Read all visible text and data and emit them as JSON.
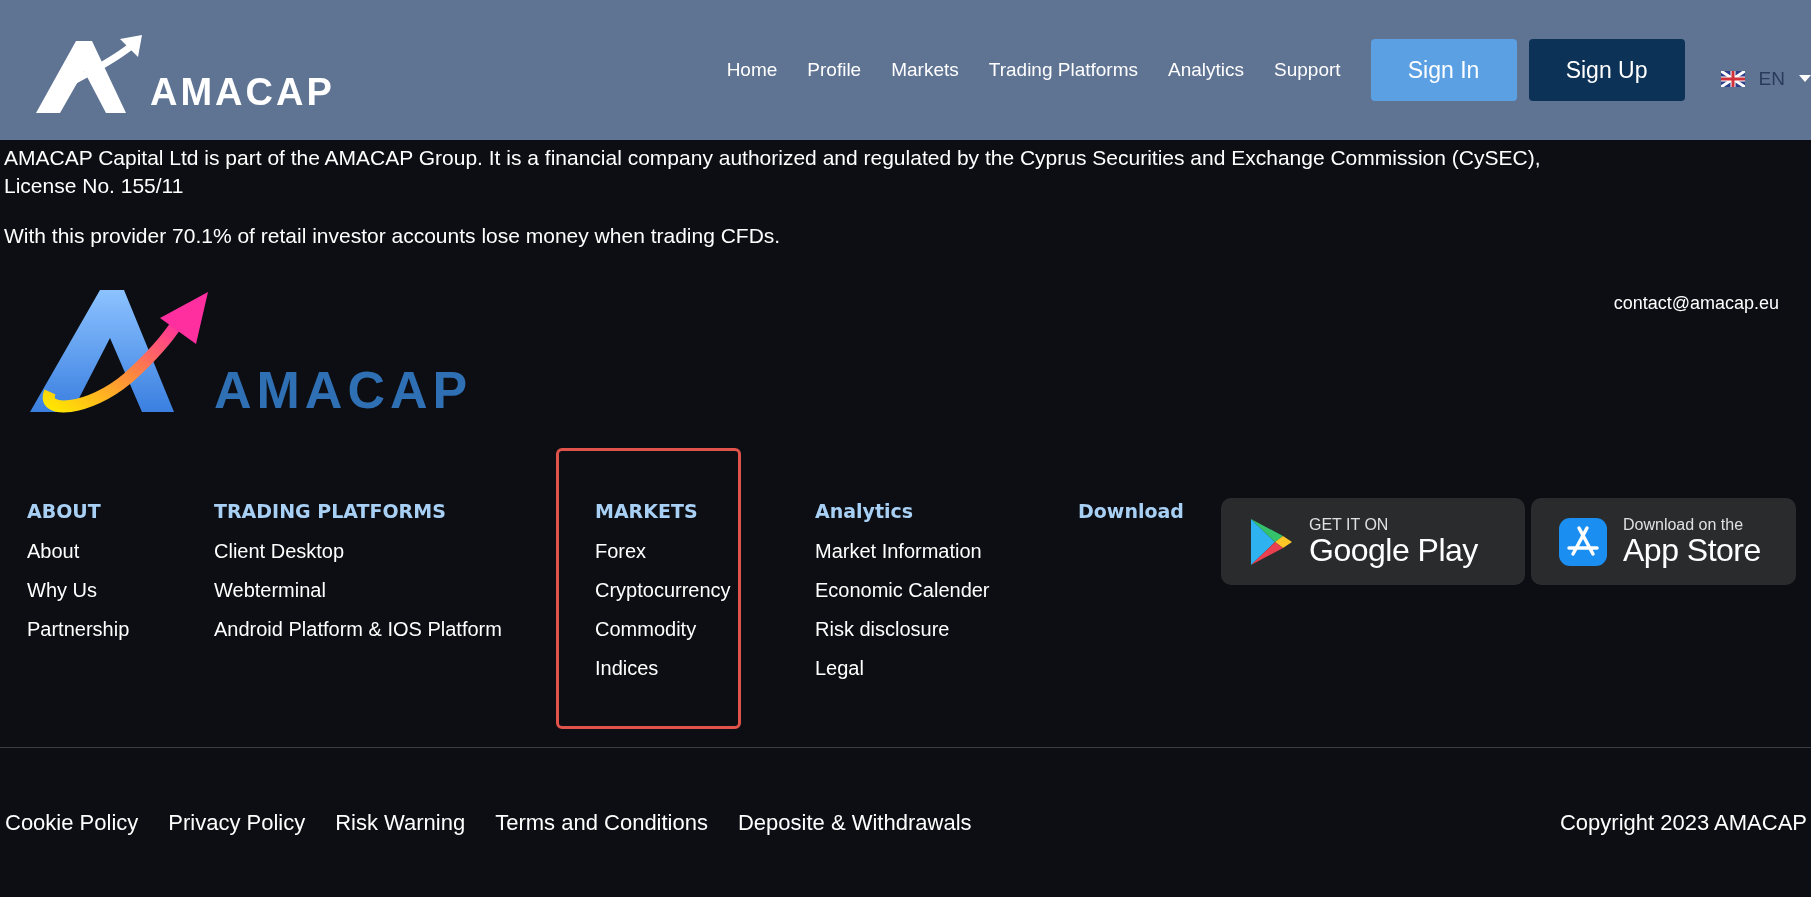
{
  "header": {
    "logo_text": "AMACAP",
    "nav": [
      "Home",
      "Profile",
      "Markets",
      "Trading Platforms",
      "Analytics",
      "Support"
    ],
    "sign_in": "Sign In",
    "sign_up": "Sign Up",
    "language": "EN"
  },
  "notice": {
    "lines": [
      "AMACAP Capital Ltd is part of the AMACAP Group. It is a financial company authorized and regulated by the Cyprus Securities and Exchange Commission (CySEC),",
      "License No. 155/11"
    ],
    "risk": "With this provider 70.1% of retail investor accounts lose money when trading CFDs."
  },
  "footer": {
    "logo_text": "AMACAP",
    "contact": "contact@amacap.eu",
    "columns": [
      {
        "title": "ABOUT",
        "highlighted": false,
        "links": [
          "About",
          "Why Us",
          "Partnership"
        ]
      },
      {
        "title": "TRADING PLATFORMS",
        "highlighted": false,
        "links": [
          "Client Desktop",
          "Webterminal",
          "Android Platform & IOS Platform"
        ]
      },
      {
        "title": "MARKETS",
        "highlighted": true,
        "links": [
          "Forex",
          "Cryptocurrency",
          "Commodity",
          "Indices"
        ]
      },
      {
        "title": "Analytics",
        "highlighted": false,
        "links": [
          "Market Information",
          "Economic Calender",
          "Risk disclosure",
          "Legal"
        ]
      },
      {
        "title": "Download",
        "highlighted": false
      }
    ],
    "badges": [
      {
        "kind": "google",
        "small": "GET IT ON",
        "big": "Google Play"
      },
      {
        "kind": "apple",
        "small": "Download on the",
        "big": "App Store"
      }
    ],
    "bottom_links": [
      "Cookie Policy",
      "Privacy Policy",
      "Risk Warning",
      "Terms and Conditions",
      "Deposite & Withdrawals"
    ],
    "copyright": "Copyright 2023 AMACAP"
  }
}
